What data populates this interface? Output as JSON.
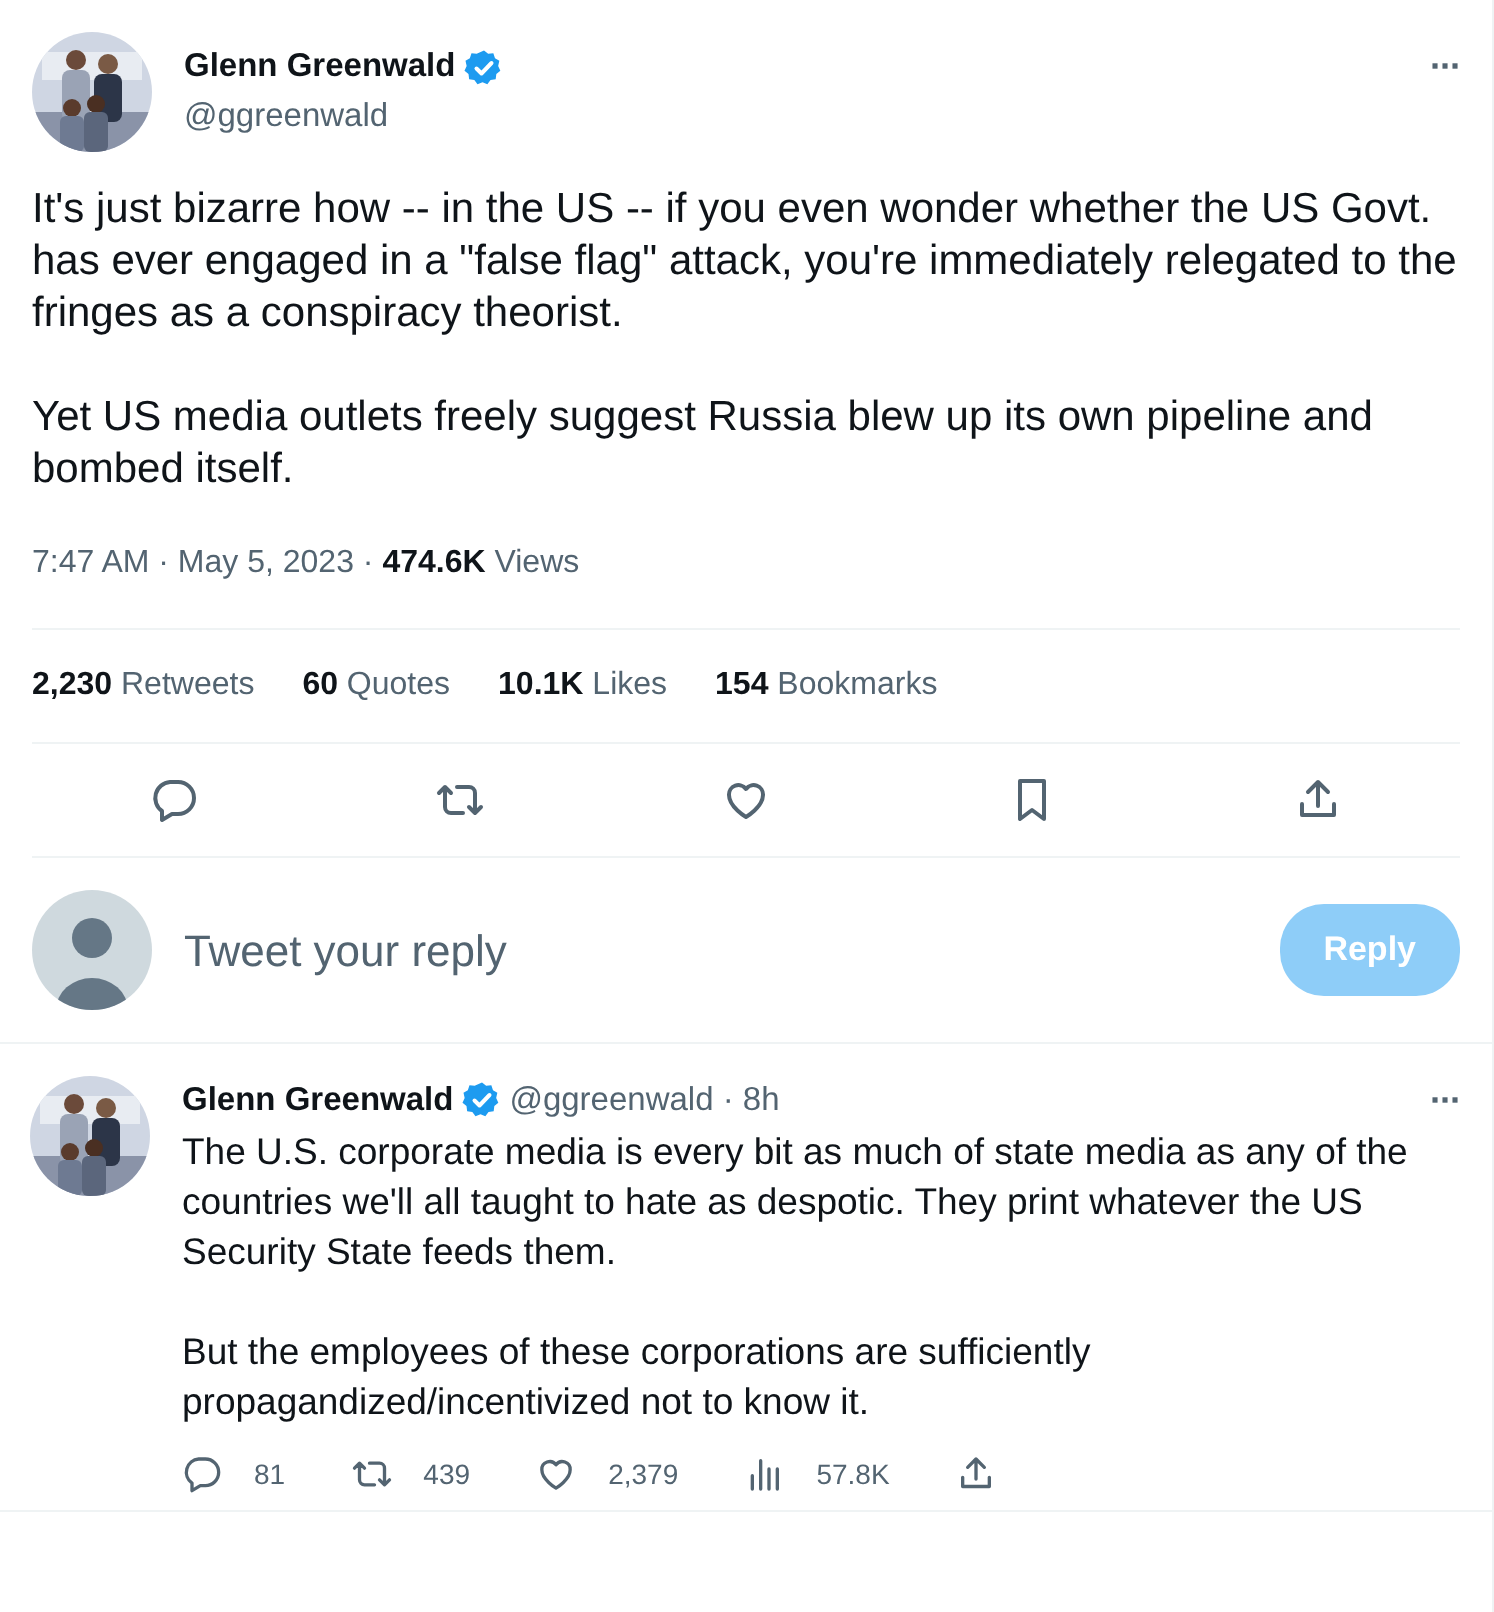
{
  "tweet": {
    "author": {
      "name": "Glenn Greenwald",
      "handle": "@ggreenwald",
      "verified": true
    },
    "paragraphs": [
      "It's just bizarre how -- in the US -- if you even wonder whether the US Govt. has ever engaged in a \"false flag\" attack, you're immediately relegated to the fringes as a conspiracy theorist.",
      "Yet US media outlets freely suggest Russia blew up its own pipeline and bombed itself."
    ],
    "meta": "7:47 AM · May 5, 2023 · **474.6K** Views",
    "stats": [
      "**2,230** Retweets",
      "**60** Quotes",
      "**10.1K** Likes",
      "**154** Bookmarks"
    ],
    "actions": [
      {
        "kind": "reply"
      },
      {
        "kind": "retweet"
      },
      {
        "kind": "like"
      },
      {
        "kind": "bookmark"
      },
      {
        "kind": "share"
      }
    ],
    "more": "···"
  },
  "reply_box": {
    "placeholder": "Tweet your reply",
    "button": "Reply",
    "disabled": true
  },
  "replies": [
    {
      "author": {
        "name": "Glenn Greenwald",
        "handle": "@ggreenwald · 8h",
        "verified": true
      },
      "paragraphs": [
        "The U.S. corporate media is every bit as much of state media as any of the countries we'll all taught to hate as despotic. They print whatever the US Security State feeds them.",
        "But the employees of these corporations are sufficiently propagandized/incentivized not to know it."
      ],
      "more": "···",
      "actions": [
        {
          "kind": "reply",
          "count": "81"
        },
        {
          "kind": "retweet",
          "count": "439"
        },
        {
          "kind": "like",
          "count": "2,379"
        },
        {
          "kind": "views",
          "count": "57.8K"
        },
        {
          "kind": "share"
        }
      ]
    }
  ]
}
